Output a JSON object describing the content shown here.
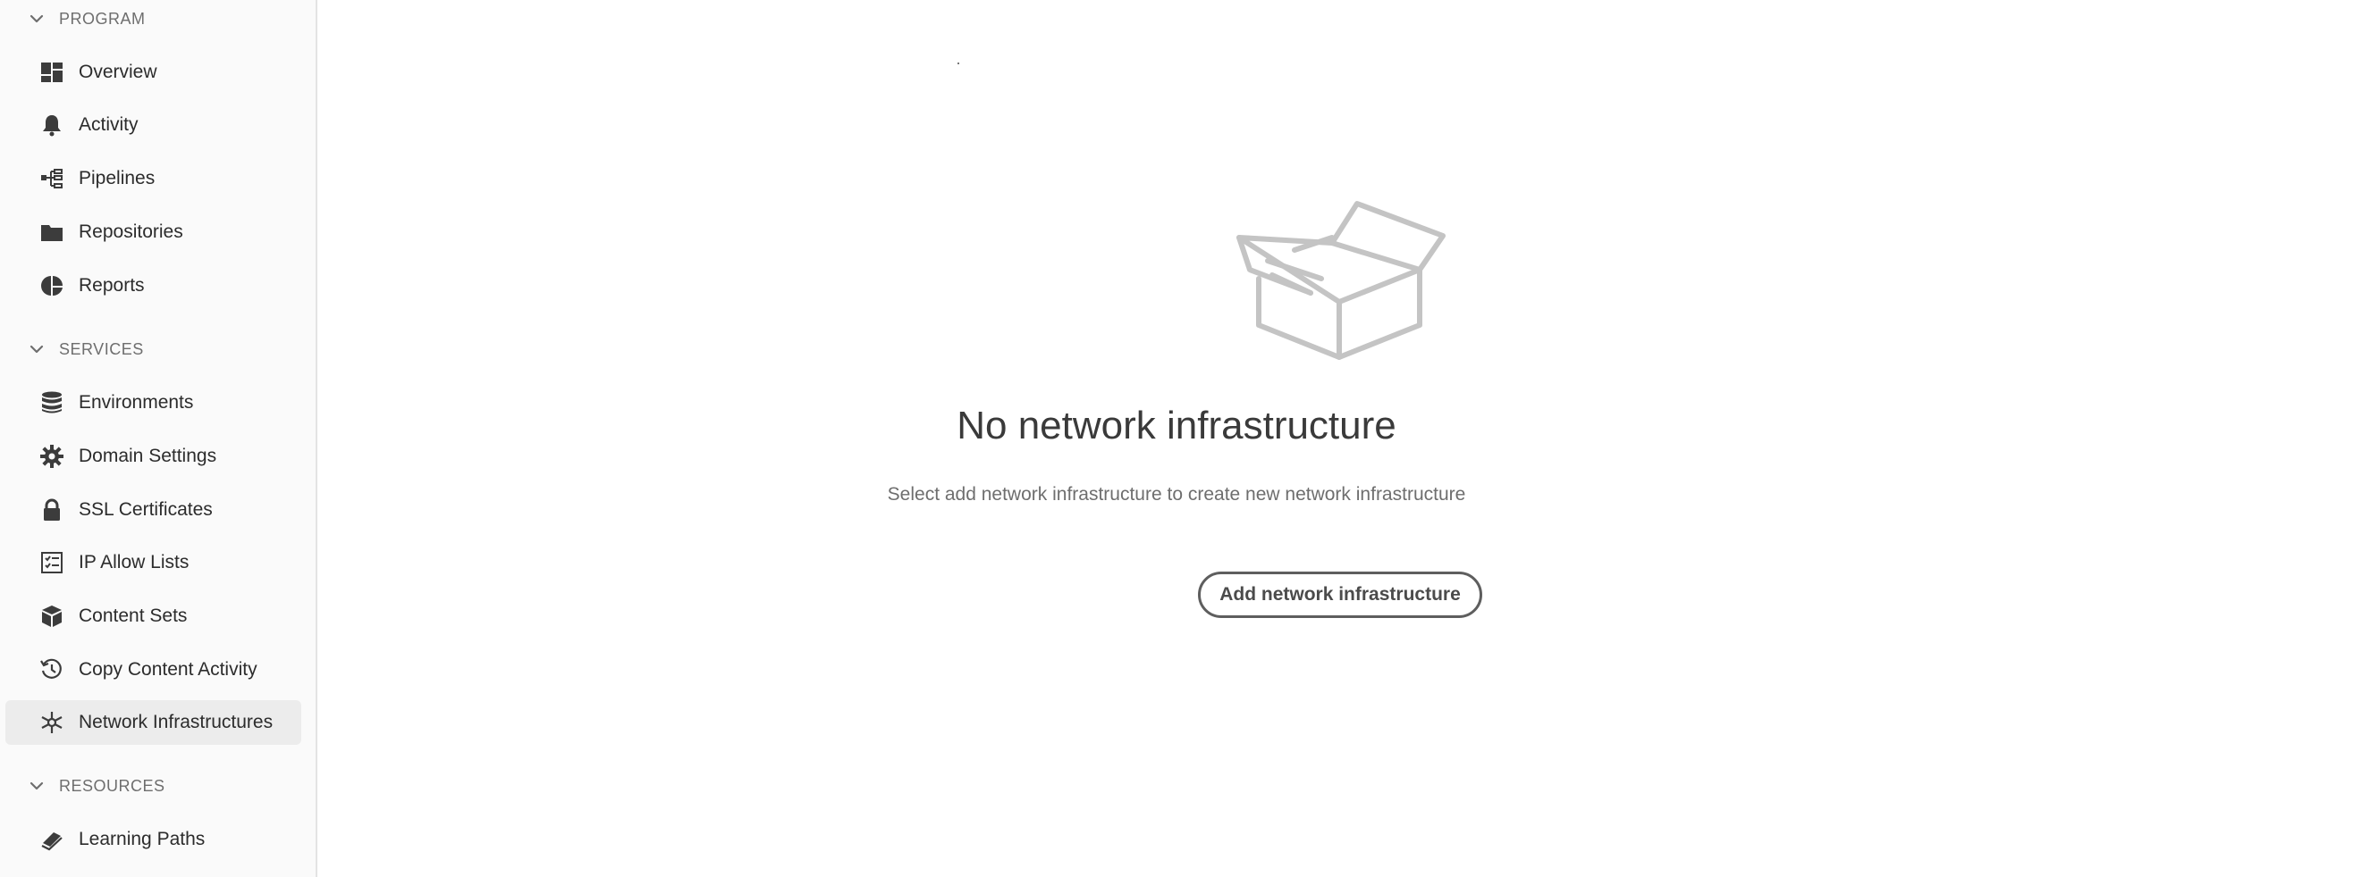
{
  "sidebar": {
    "sections": {
      "program": {
        "label": "PROGRAM"
      },
      "services": {
        "label": "SERVICES"
      },
      "resources": {
        "label": "RESOURCES"
      }
    },
    "items": {
      "overview": {
        "label": "Overview",
        "icon": "dashboard-icon"
      },
      "activity": {
        "label": "Activity",
        "icon": "bell-icon"
      },
      "pipelines": {
        "label": "Pipelines",
        "icon": "pipeline-icon"
      },
      "repositories": {
        "label": "Repositories",
        "icon": "folder-icon"
      },
      "reports": {
        "label": "Reports",
        "icon": "pie-chart-icon"
      },
      "environments": {
        "label": "Environments",
        "icon": "database-icon"
      },
      "domain_settings": {
        "label": "Domain Settings",
        "icon": "gear-icon"
      },
      "ssl_certificates": {
        "label": "SSL Certificates",
        "icon": "lock-icon"
      },
      "ip_allow_lists": {
        "label": "IP Allow Lists",
        "icon": "checklist-icon"
      },
      "content_sets": {
        "label": "Content Sets",
        "icon": "box-icon"
      },
      "copy_content_activity": {
        "label": "Copy Content Activity",
        "icon": "history-icon"
      },
      "network_infrastructures": {
        "label": "Network Infrastructures",
        "icon": "network-icon",
        "selected": true
      },
      "learning_paths": {
        "label": "Learning Paths",
        "icon": "learning-icon"
      }
    }
  },
  "empty_state": {
    "illustration": "empty-box-icon",
    "title": "No network infrastructure",
    "description": "Select add network infrastructure to create new network infrastructure",
    "button_label": "Add network infrastructure"
  },
  "colors": {
    "sidebar_bg": "#fafafa",
    "selected_bg": "#ececec",
    "text": "#2c2c2c",
    "muted": "#6e6e6e",
    "illustration": "#c4c4c4"
  }
}
